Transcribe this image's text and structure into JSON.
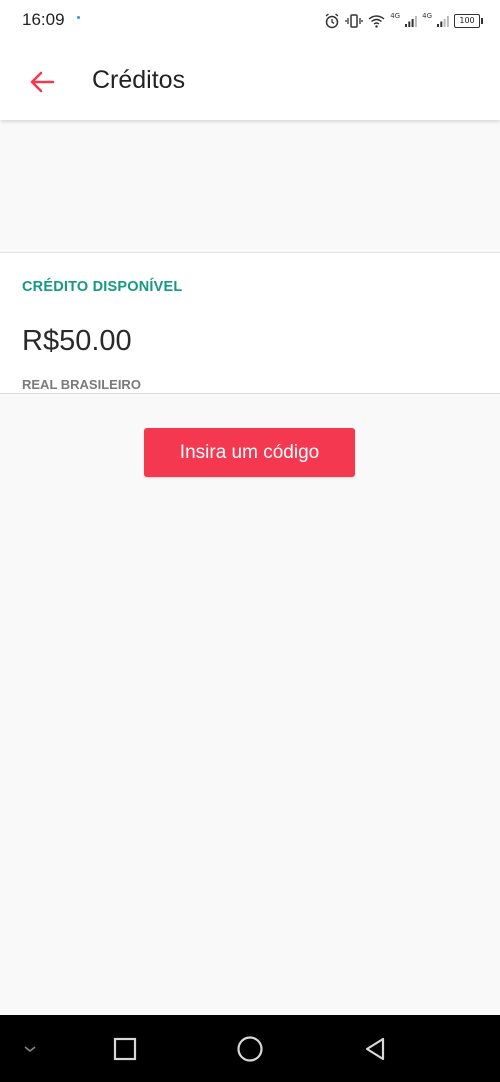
{
  "status_bar": {
    "time": "16:09",
    "network_1": "4G",
    "network_2": "4G",
    "battery": "100"
  },
  "app_bar": {
    "title": "Créditos"
  },
  "credit": {
    "label": "CRÉDITO DISPONÍVEL",
    "amount": "R$50.00",
    "currency": "REAL BRASILEIRO"
  },
  "actions": {
    "insert_code_label": "Insira um código"
  },
  "colors": {
    "accent": "#f4384f",
    "label_green": "#149a84"
  },
  "icons": {
    "back": "arrow-left-icon",
    "nav_down": "chevron-down-icon",
    "nav_recents": "square-icon",
    "nav_home": "circle-icon",
    "nav_back": "triangle-back-icon"
  }
}
